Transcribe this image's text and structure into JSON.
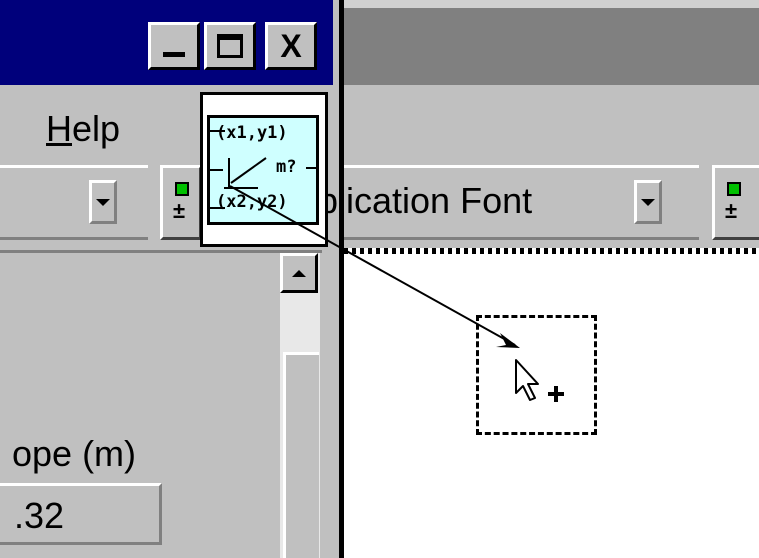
{
  "front_panel": {
    "title_buttons": {
      "minimize": "_",
      "maximize": "□",
      "close": "X"
    },
    "menu": {
      "help": "Help",
      "help_accel": "H",
      "help_rest": "elp"
    },
    "slope_label": "ope (m)",
    "slope_value": ".32"
  },
  "block_diagram": {
    "font_selector": "plication Font"
  },
  "drag_icon": {
    "line1": "(x1,y1)",
    "line2": "m?",
    "line3": "(x2,y2)"
  },
  "icons": {
    "cursor": "copy-cursor-icon",
    "scroll_up": "triangle-up-icon",
    "dropdown": "triangle-down-icon"
  },
  "colors": {
    "title_active": "#00007b",
    "title_inactive": "#808080",
    "face": "#c0c0c0",
    "icon_bg": "#cfffff"
  }
}
